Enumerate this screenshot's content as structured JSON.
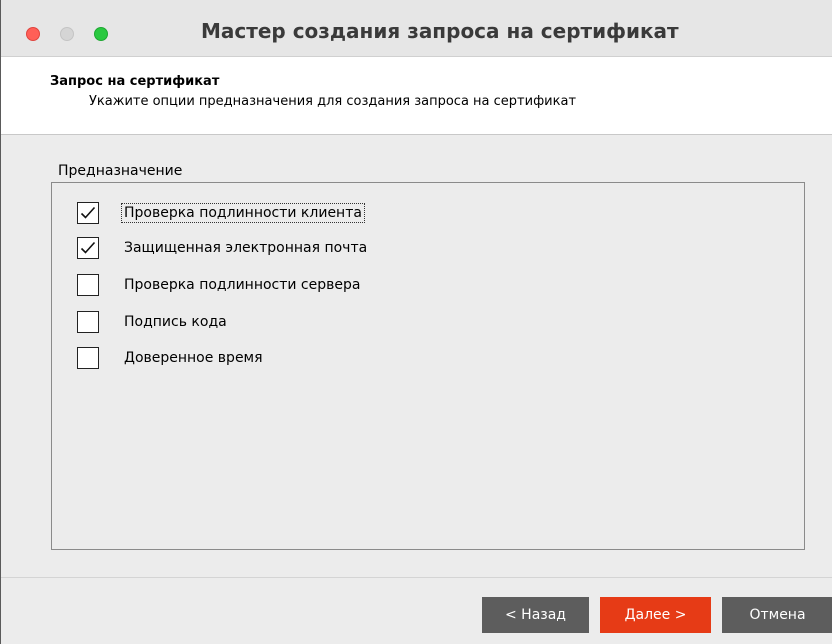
{
  "window": {
    "title": "Мастер создания запроса на сертификат"
  },
  "header": {
    "title": "Запрос на сертификат",
    "subtitle": "Укажите опции предназначения для создания запроса на сертификат"
  },
  "purpose": {
    "group_label": "Предназначение",
    "options": [
      {
        "label": "Проверка подлинности клиента",
        "checked": true
      },
      {
        "label": "Защищенная электронная почта",
        "checked": true
      },
      {
        "label": "Проверка подлинности сервера",
        "checked": false
      },
      {
        "label": "Подпись кода",
        "checked": false
      },
      {
        "label": "Доверенное время",
        "checked": false
      }
    ]
  },
  "buttons": {
    "back": "< Назад",
    "next": "Далее >",
    "cancel": "Отмена"
  },
  "colors": {
    "next_button": "#e63b16",
    "secondary_button": "#5d5d5d",
    "close_dot": "#ff5f57",
    "zoom_dot": "#2ac940"
  },
  "icons": {
    "checkmark": "checkmark-icon"
  }
}
